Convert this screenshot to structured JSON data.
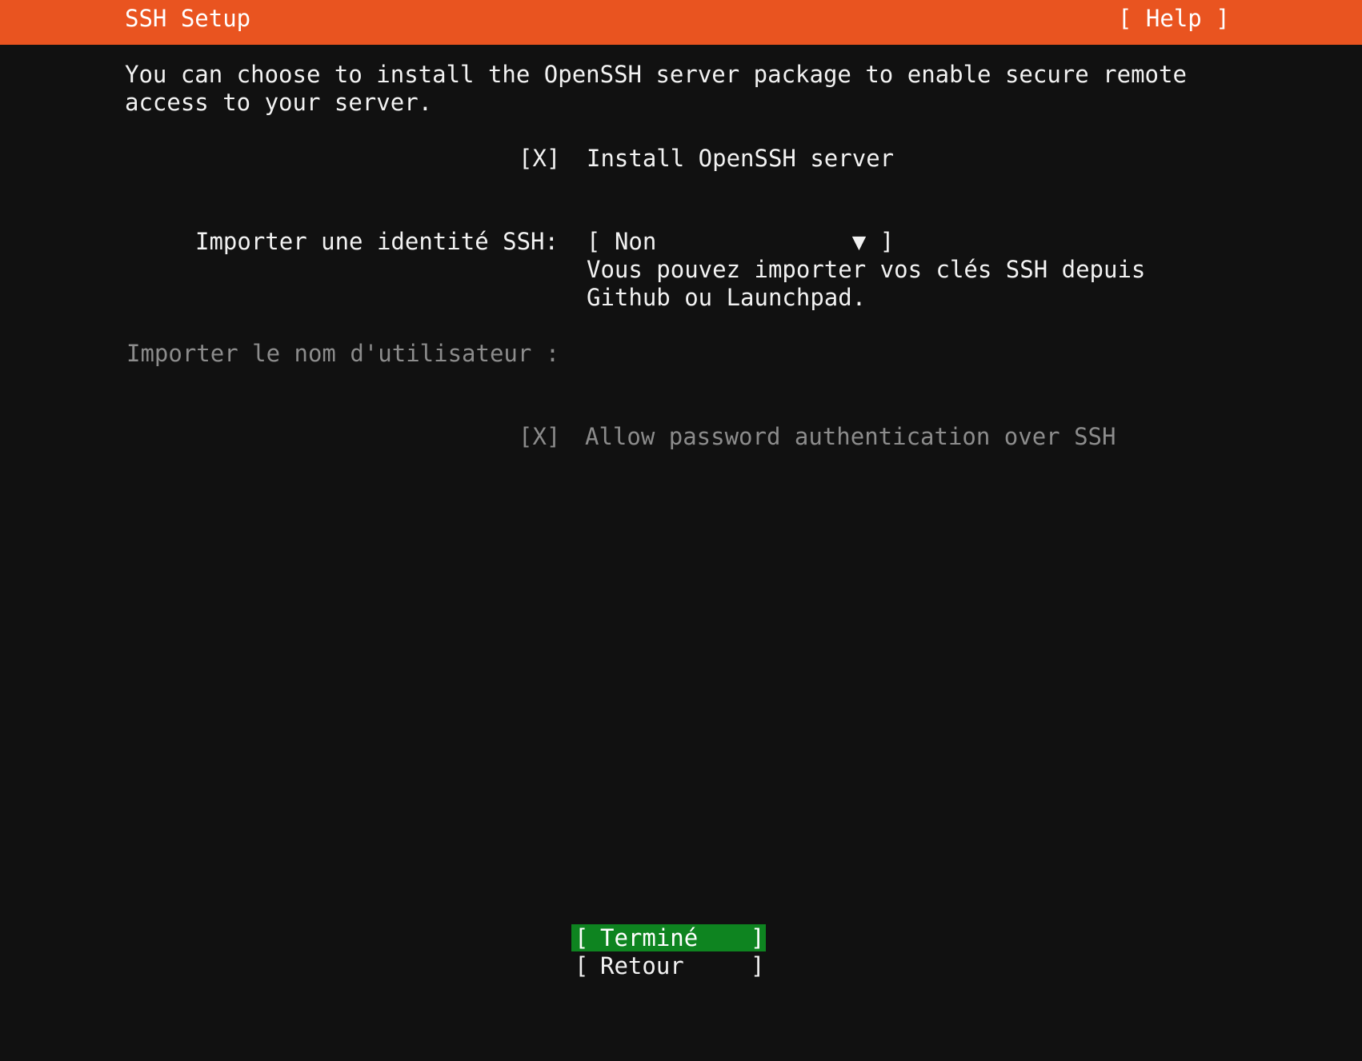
{
  "header": {
    "title": "SSH Setup",
    "help": "[ Help ]"
  },
  "intro": {
    "line1": "You can choose to install the OpenSSH server package to enable secure remote",
    "line2": "access to your server."
  },
  "install_openssh": {
    "checkbox": "[X]",
    "label": "Install OpenSSH server",
    "checked": true
  },
  "import_identity": {
    "label": "Importer une identité SSH:",
    "select_open": "[",
    "value": "Non",
    "arrow": "▼",
    "select_close": "]",
    "help_line1": "Vous pouvez importer vos clés SSH depuis",
    "help_line2": "Github ou Launchpad."
  },
  "import_username": {
    "label": "Importer le nom d'utilisateur :"
  },
  "allow_password": {
    "checkbox": "[X]",
    "label": "Allow password authentication over SSH",
    "checked": true
  },
  "buttons": {
    "done": {
      "open": "[",
      "label": "Terminé",
      "close": "]"
    },
    "back": {
      "open": "[",
      "label": "Retour",
      "close": "]"
    }
  },
  "colors": {
    "header_bg": "#e95420",
    "background": "#111111",
    "focus_button_bg": "#0e8420",
    "text": "#f2f2f2",
    "disabled_text": "#8c8c8c"
  }
}
